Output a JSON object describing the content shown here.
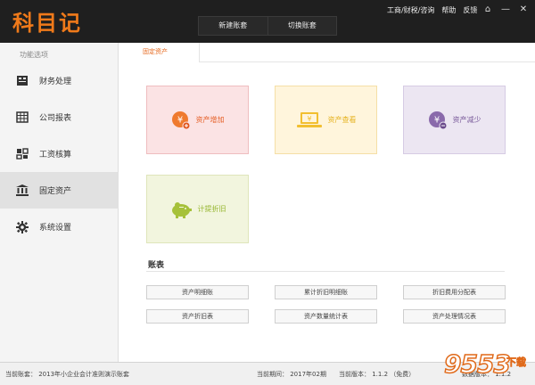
{
  "app": {
    "logo_text": "科目记",
    "top_tabs": [
      "新建账套",
      "切换账套"
    ],
    "top_links": [
      "工商/财税/咨询",
      "帮助",
      "反馈"
    ],
    "window_controls": [
      "⌂",
      "—",
      "✕"
    ]
  },
  "sidebar": {
    "heading": "功能选项",
    "items": [
      {
        "label": "财务处理",
        "icon": "ledger-book-icon"
      },
      {
        "label": "公司报表",
        "icon": "table-grid-icon"
      },
      {
        "label": "工资核算",
        "icon": "quad-grid-icon"
      },
      {
        "label": "固定资产",
        "icon": "bank-building-icon",
        "active": true
      },
      {
        "label": "系统设置",
        "icon": "gear-icon"
      }
    ]
  },
  "content": {
    "active_tab": "固定资产",
    "tiles": [
      {
        "label": "资产增加",
        "icon": "yen-coin-plus-icon"
      },
      {
        "label": "资产查看",
        "icon": "yen-laptop-icon"
      },
      {
        "label": "资产减少",
        "icon": "yen-coin-minus-icon"
      },
      {
        "label": "计提折旧",
        "icon": "piggy-bank-icon"
      }
    ],
    "reports_title": "账表",
    "reports": [
      "资产明细账",
      "累计折旧明细账",
      "折旧费用分配表",
      "资产折旧表",
      "资产数量统计表",
      "资产处理情况表"
    ]
  },
  "status": {
    "account": "当前账套：  2013年小企业会计准则演示账套",
    "period": "当前期间：  2017年02期",
    "version": "当前版本：  1.1.2  （免费）",
    "db_version": "数据版本：  1.1.2"
  },
  "watermark": {
    "number": "9553",
    "text": "下载"
  },
  "colors": {
    "titlebar": "#1f1f1f",
    "logo": "#f07a1a",
    "accent_tab": "#e6661a",
    "tile_add": "#fbe3e4",
    "tile_view": "#fff5dc",
    "tile_reduce": "#ece6f2",
    "tile_depr": "#f2f5de"
  }
}
